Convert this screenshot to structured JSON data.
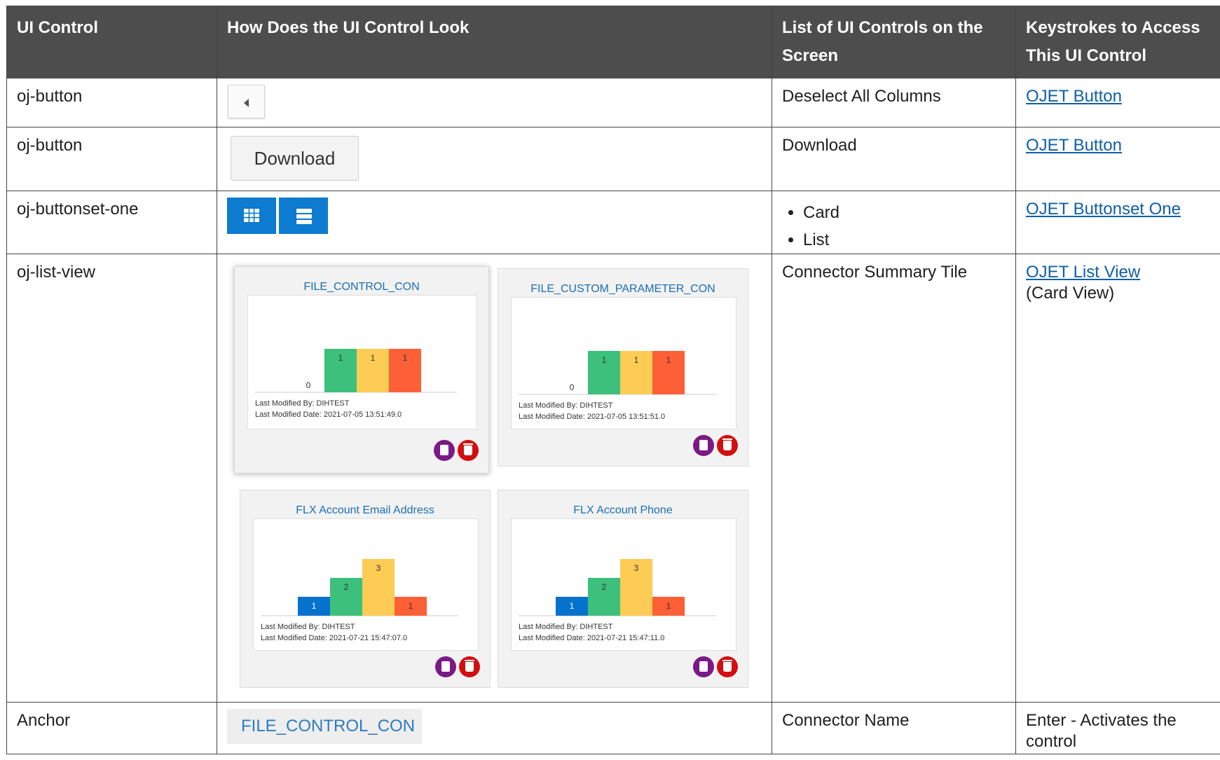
{
  "headers": [
    "UI Control",
    "How Does the UI Control Look",
    "List of UI Controls on the Screen",
    "Keystrokes to Access This UI Control"
  ],
  "rows": [
    {
      "control": "oj-button",
      "screen": "Deselect All Columns",
      "key_link": "OJET Button"
    },
    {
      "control": "oj-button",
      "button_label": "Download",
      "screen": "Download",
      "key_link": "OJET Button"
    },
    {
      "control": "oj-buttonset-one",
      "screen_items": [
        "Card",
        "List"
      ],
      "key_link": "OJET Buttonset One",
      "icons": [
        "grid-icon",
        "list-icon"
      ]
    },
    {
      "control": "oj-list-view",
      "screen": "Connector Summary Tile",
      "key_link": "OJET List View",
      "key_note": "(Card View)"
    },
    {
      "control": "Anchor",
      "anchor_label": "FILE_CONTROL_CON",
      "screen": "Connector Name",
      "key_text": "Enter - Activates the control"
    }
  ],
  "tiles": [
    {
      "name": "FILE_CONTROL_CON",
      "values": [
        0,
        1,
        1,
        1
      ],
      "modified_by_label": "Last Modified By:",
      "modified_by": "DIHTEST",
      "modified_date_label": "Last Modified Date:",
      "modified_date": "2021-07-05 13:51:49.0"
    },
    {
      "name": "FILE_CUSTOM_PARAMETER_CON",
      "values": [
        0,
        1,
        1,
        1
      ],
      "modified_by_label": "Last Modified By:",
      "modified_by": "DIHTEST",
      "modified_date_label": "Last Modified Date:",
      "modified_date": "2021-07-05 13:51:51.0"
    },
    {
      "name": "FLX Account Email Address",
      "values": [
        1,
        2,
        3,
        1
      ],
      "modified_by_label": "Last Modified By:",
      "modified_by": "DIHTEST",
      "modified_date_label": "Last Modified Date:",
      "modified_date": "2021-07-21 15:47:07.0"
    },
    {
      "name": "FLX Account Phone",
      "values": [
        1,
        2,
        3,
        1
      ],
      "modified_by_label": "Last Modified By:",
      "modified_by": "DIHTEST",
      "modified_date_label": "Last Modified Date:",
      "modified_date": "2021-07-21 15:47:11.0"
    }
  ],
  "chart_data": [
    {
      "type": "bar",
      "categories": [
        "",
        "",
        "",
        ""
      ],
      "values": [
        0,
        1,
        1,
        1
      ],
      "colors": [
        "#0572ce",
        "#3cc07c",
        "#fdcc55",
        "#fd5f36"
      ]
    },
    {
      "type": "bar",
      "categories": [
        "",
        "",
        "",
        ""
      ],
      "values": [
        0,
        1,
        1,
        1
      ],
      "colors": [
        "#0572ce",
        "#3cc07c",
        "#fdcc55",
        "#fd5f36"
      ]
    },
    {
      "type": "bar",
      "categories": [
        "",
        "",
        "",
        ""
      ],
      "values": [
        1,
        2,
        3,
        1
      ],
      "colors": [
        "#0572ce",
        "#3cc07c",
        "#fdcc55",
        "#fd5f36"
      ]
    },
    {
      "type": "bar",
      "categories": [
        "",
        "",
        "",
        ""
      ],
      "values": [
        1,
        2,
        3,
        1
      ],
      "colors": [
        "#0572ce",
        "#3cc07c",
        "#fdcc55",
        "#fd5f36"
      ]
    }
  ],
  "colors": {
    "header_bg": "#4d4d4d",
    "link": "#0f5fa6",
    "buttonset": "#0c7bd0",
    "copy_icon": "#7a1a86",
    "delete_icon": "#d10f10"
  }
}
